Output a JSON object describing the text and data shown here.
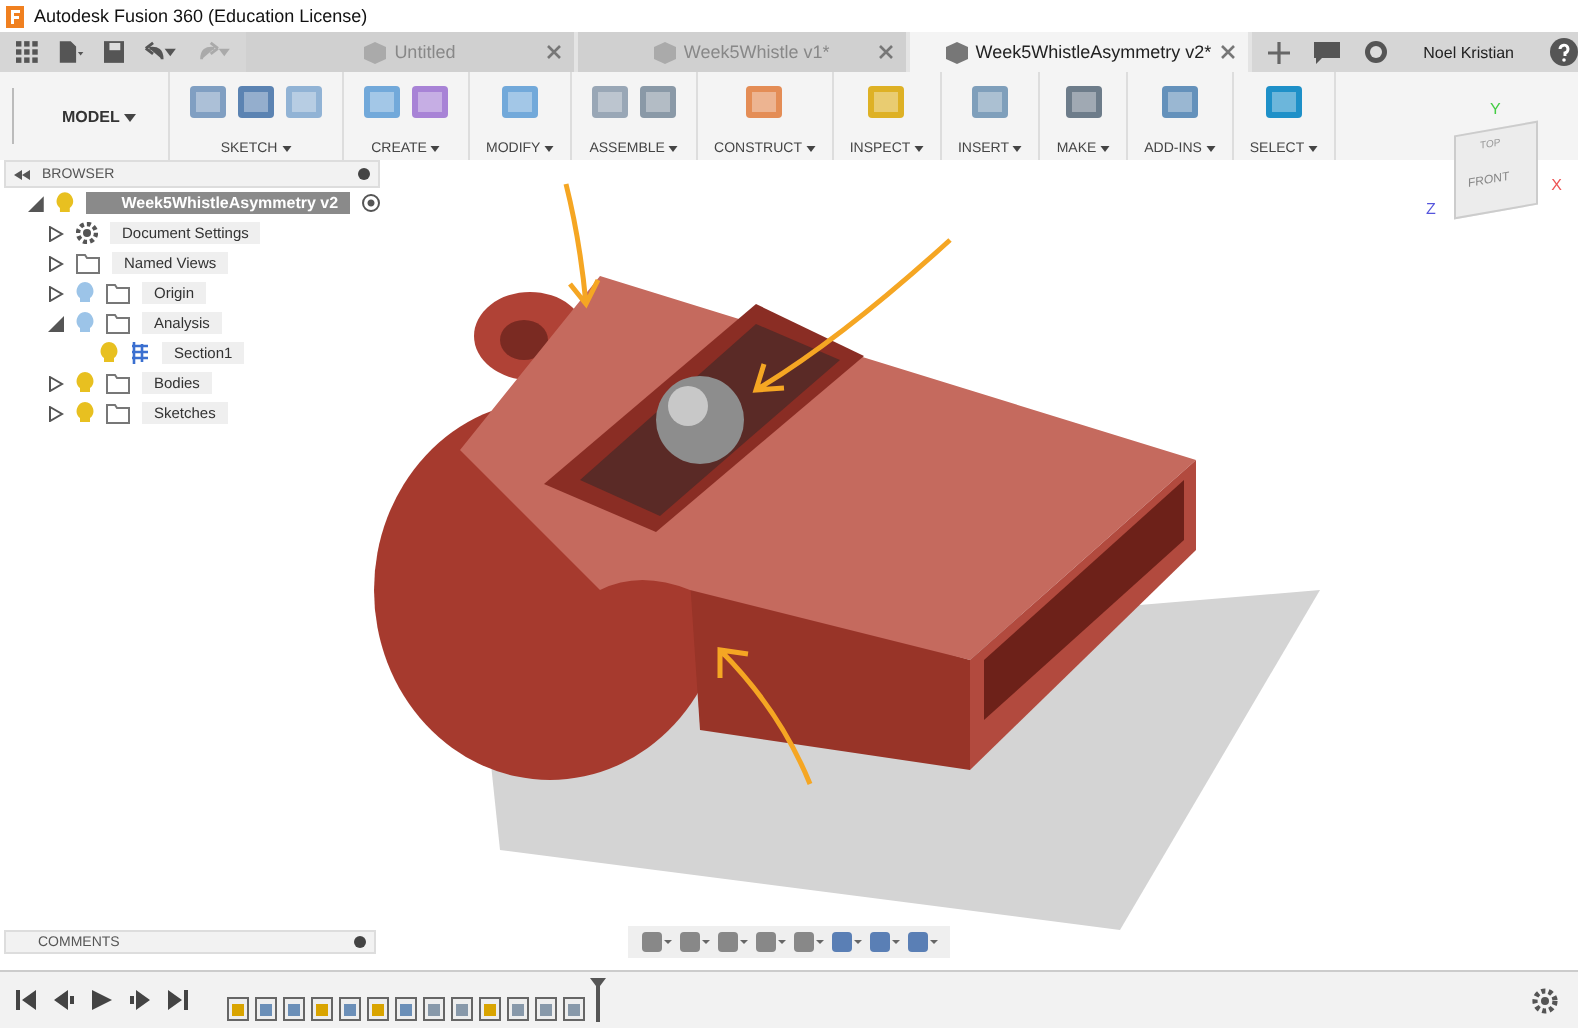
{
  "window": {
    "title": "Autodesk Fusion 360 (Education License)"
  },
  "tabs": [
    {
      "label": "Untitled",
      "selected": false
    },
    {
      "label": "Week5Whistle v1*",
      "selected": false
    },
    {
      "label": "Week5WhistleAsymmetry v2*",
      "selected": true
    }
  ],
  "user": {
    "name": "Noel Kristian"
  },
  "toolbar": {
    "workspace": "MODEL",
    "groups": [
      {
        "kind": "sketch",
        "label": "SKETCH"
      },
      {
        "kind": "create",
        "label": "CREATE"
      },
      {
        "kind": "modify",
        "label": "MODIFY"
      },
      {
        "kind": "assemble",
        "label": "ASSEMBLE"
      },
      {
        "kind": "construct",
        "label": "CONSTRUCT"
      },
      {
        "kind": "inspect",
        "label": "INSPECT"
      },
      {
        "kind": "insert",
        "label": "INSERT"
      },
      {
        "kind": "make",
        "label": "MAKE"
      },
      {
        "kind": "addins",
        "label": "ADD-INS"
      },
      {
        "kind": "select",
        "label": "SELECT"
      }
    ]
  },
  "viewcube": {
    "top": "TOP",
    "front": "FRONT",
    "axis_x": "X",
    "axis_y": "Y",
    "axis_z": "Z"
  },
  "browser": {
    "title": "BROWSER",
    "root": {
      "label": "Week5WhistleAsymmetry v2",
      "selected": true,
      "expanded": true,
      "visible": true,
      "children": [
        {
          "label": "Document Settings",
          "kind": "settings",
          "selected": false,
          "expanded": false
        },
        {
          "label": "Named Views",
          "kind": "folder",
          "selected": false,
          "expanded": false
        },
        {
          "label": "Origin",
          "kind": "folder",
          "selected": false,
          "expanded": false,
          "visible": false
        },
        {
          "label": "Analysis",
          "kind": "folder",
          "selected": false,
          "expanded": true,
          "visible": false,
          "children": [
            {
              "label": "Section1",
              "kind": "section",
              "selected": false,
              "visible": true
            }
          ]
        },
        {
          "label": "Bodies",
          "kind": "folder",
          "selected": false,
          "expanded": false,
          "visible": true
        },
        {
          "label": "Sketches",
          "kind": "folder",
          "selected": false,
          "expanded": false,
          "visible": true
        }
      ]
    }
  },
  "comments": {
    "title": "COMMENTS"
  }
}
